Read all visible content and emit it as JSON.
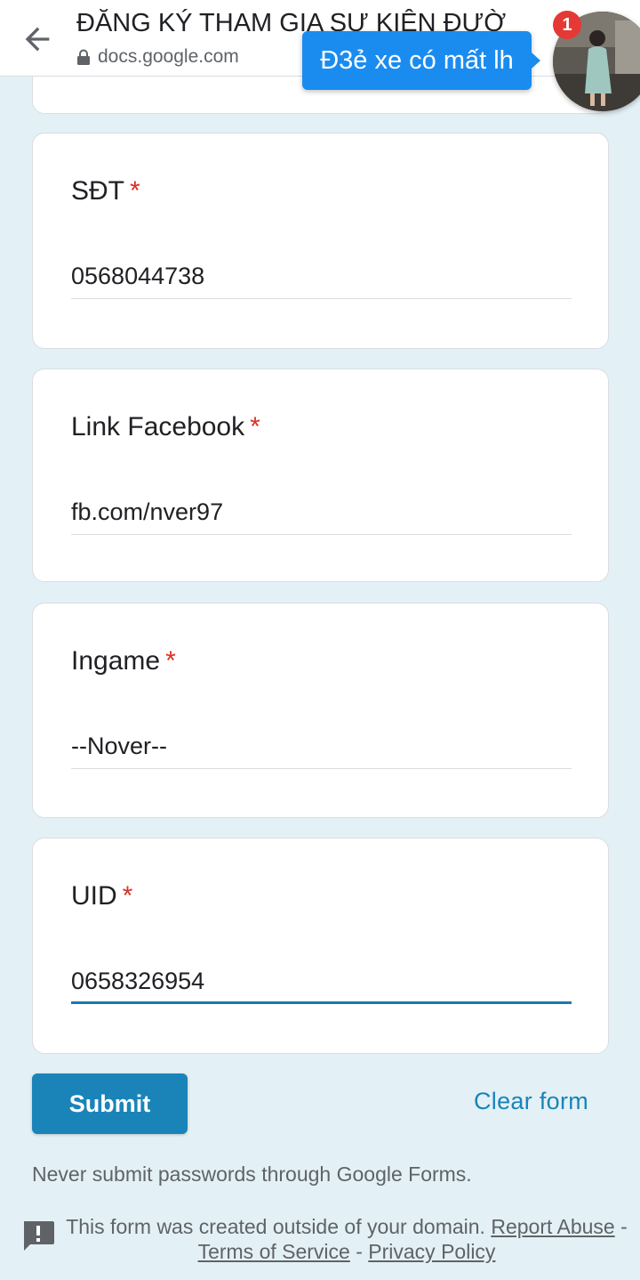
{
  "browser": {
    "title": "ĐĂNG KÝ THAM GIA SỰ KIỆN ĐƯỜ",
    "url": "docs.google.com"
  },
  "chat_overlay": {
    "message": "Đ3ẻ xe có mất lh",
    "badge_count": "1"
  },
  "form": {
    "fields": [
      {
        "label": "SĐT",
        "required_mark": "*",
        "value": "0568044738"
      },
      {
        "label": "Link Facebook",
        "required_mark": "*",
        "value": "fb.com/nver97"
      },
      {
        "label": "Ingame",
        "required_mark": "*",
        "value": "--Nover--"
      },
      {
        "label": "UID",
        "required_mark": "*",
        "value": "0658326954"
      }
    ],
    "submit_label": "Submit",
    "clear_label": "Clear form"
  },
  "footer": {
    "password_warning": "Never submit passwords through Google Forms.",
    "domain_notice": "This form was created outside of your domain.",
    "report_link": "Report Abuse",
    "separator": "-",
    "terms_link": "Terms of Service",
    "privacy_link": "Privacy Policy"
  },
  "colors": {
    "page_background": "#e3f1f6",
    "accent": "#1a84b9",
    "required": "#d93025",
    "chat_bubble": "#1a8cf0"
  },
  "icons": [
    "back-arrow-icon",
    "lock-icon",
    "feedback-icon"
  ]
}
